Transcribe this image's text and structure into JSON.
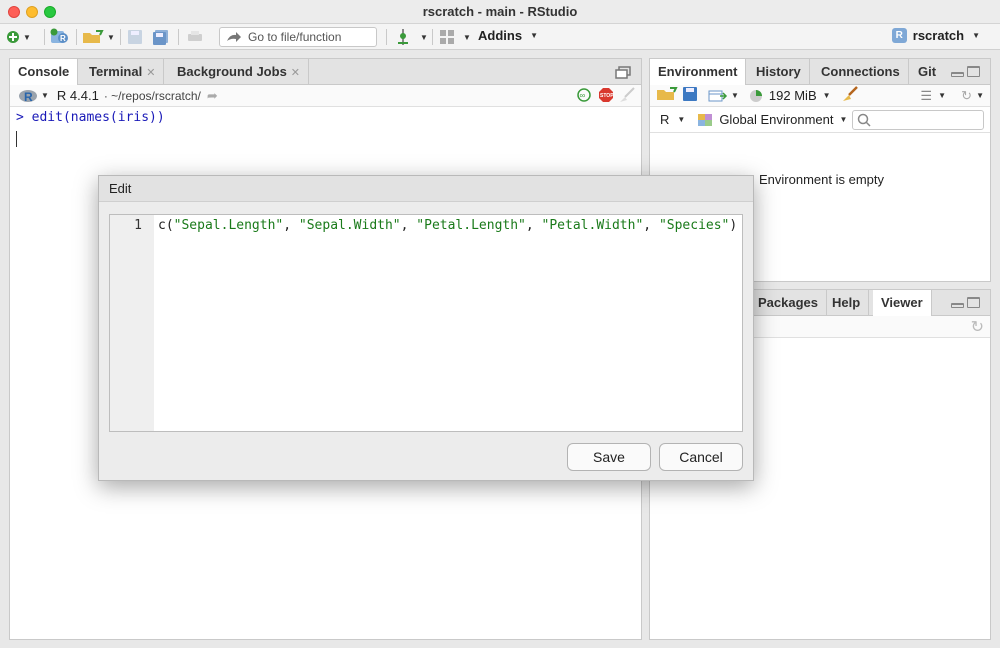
{
  "window": {
    "title": "rscratch - main - RStudio"
  },
  "toolbar": {
    "goto_placeholder": "Go to file/function",
    "addins_label": "Addins",
    "project_label": "rscratch",
    "project_badge": "R"
  },
  "console_pane": {
    "tabs": [
      "Console",
      "Terminal",
      "Background Jobs"
    ],
    "r_version": "R 4.4.1",
    "path": "· ~/repos/rscratch/",
    "r_logo": "R",
    "prompt_line": "> edit(names(iris))"
  },
  "env_pane": {
    "tabs": [
      "Environment",
      "History",
      "Connections",
      "Git"
    ],
    "memory": "192 MiB",
    "language": "R",
    "scope": "Global Environment",
    "search_placeholder": "",
    "empty_message": "Environment is empty"
  },
  "files_pane": {
    "tabs": [
      "Packages",
      "Help",
      "Viewer"
    ]
  },
  "dialog": {
    "title": "Edit",
    "line_number": "1",
    "code_prefix": "c(",
    "code_strings": [
      "\"Sepal.Length\"",
      "\"Sepal.Width\"",
      "\"Petal.Length\"",
      "\"Petal.Width\"",
      "\"Species\""
    ],
    "code_suffix": ")",
    "save_label": "Save",
    "cancel_label": "Cancel"
  },
  "colors": {
    "prompt_blue": "#1a1ab8",
    "string_green": "#1a7a1a",
    "accent_blue": "#3d79c2"
  }
}
